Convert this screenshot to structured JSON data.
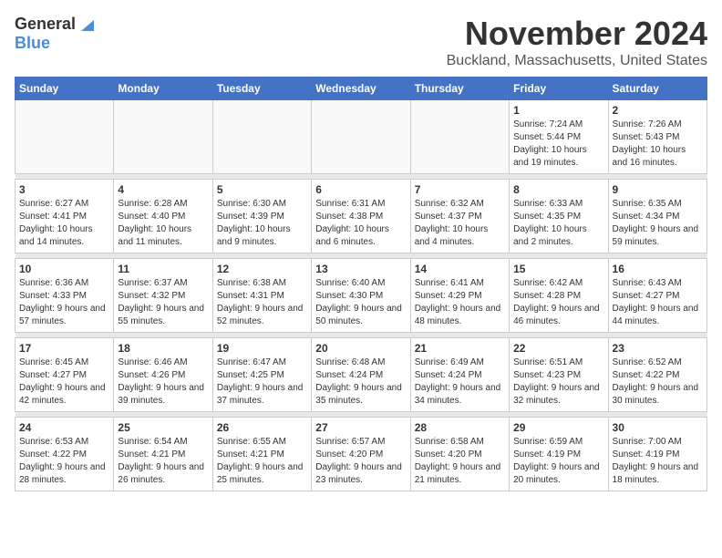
{
  "logo": {
    "general": "General",
    "blue": "Blue"
  },
  "header": {
    "month": "November 2024",
    "location": "Buckland, Massachusetts, United States"
  },
  "weekdays": [
    "Sunday",
    "Monday",
    "Tuesday",
    "Wednesday",
    "Thursday",
    "Friday",
    "Saturday"
  ],
  "weeks": [
    [
      {
        "day": "",
        "info": ""
      },
      {
        "day": "",
        "info": ""
      },
      {
        "day": "",
        "info": ""
      },
      {
        "day": "",
        "info": ""
      },
      {
        "day": "",
        "info": ""
      },
      {
        "day": "1",
        "info": "Sunrise: 7:24 AM\nSunset: 5:44 PM\nDaylight: 10 hours and 19 minutes."
      },
      {
        "day": "2",
        "info": "Sunrise: 7:26 AM\nSunset: 5:43 PM\nDaylight: 10 hours and 16 minutes."
      }
    ],
    [
      {
        "day": "3",
        "info": "Sunrise: 6:27 AM\nSunset: 4:41 PM\nDaylight: 10 hours and 14 minutes."
      },
      {
        "day": "4",
        "info": "Sunrise: 6:28 AM\nSunset: 4:40 PM\nDaylight: 10 hours and 11 minutes."
      },
      {
        "day": "5",
        "info": "Sunrise: 6:30 AM\nSunset: 4:39 PM\nDaylight: 10 hours and 9 minutes."
      },
      {
        "day": "6",
        "info": "Sunrise: 6:31 AM\nSunset: 4:38 PM\nDaylight: 10 hours and 6 minutes."
      },
      {
        "day": "7",
        "info": "Sunrise: 6:32 AM\nSunset: 4:37 PM\nDaylight: 10 hours and 4 minutes."
      },
      {
        "day": "8",
        "info": "Sunrise: 6:33 AM\nSunset: 4:35 PM\nDaylight: 10 hours and 2 minutes."
      },
      {
        "day": "9",
        "info": "Sunrise: 6:35 AM\nSunset: 4:34 PM\nDaylight: 9 hours and 59 minutes."
      }
    ],
    [
      {
        "day": "10",
        "info": "Sunrise: 6:36 AM\nSunset: 4:33 PM\nDaylight: 9 hours and 57 minutes."
      },
      {
        "day": "11",
        "info": "Sunrise: 6:37 AM\nSunset: 4:32 PM\nDaylight: 9 hours and 55 minutes."
      },
      {
        "day": "12",
        "info": "Sunrise: 6:38 AM\nSunset: 4:31 PM\nDaylight: 9 hours and 52 minutes."
      },
      {
        "day": "13",
        "info": "Sunrise: 6:40 AM\nSunset: 4:30 PM\nDaylight: 9 hours and 50 minutes."
      },
      {
        "day": "14",
        "info": "Sunrise: 6:41 AM\nSunset: 4:29 PM\nDaylight: 9 hours and 48 minutes."
      },
      {
        "day": "15",
        "info": "Sunrise: 6:42 AM\nSunset: 4:28 PM\nDaylight: 9 hours and 46 minutes."
      },
      {
        "day": "16",
        "info": "Sunrise: 6:43 AM\nSunset: 4:27 PM\nDaylight: 9 hours and 44 minutes."
      }
    ],
    [
      {
        "day": "17",
        "info": "Sunrise: 6:45 AM\nSunset: 4:27 PM\nDaylight: 9 hours and 42 minutes."
      },
      {
        "day": "18",
        "info": "Sunrise: 6:46 AM\nSunset: 4:26 PM\nDaylight: 9 hours and 39 minutes."
      },
      {
        "day": "19",
        "info": "Sunrise: 6:47 AM\nSunset: 4:25 PM\nDaylight: 9 hours and 37 minutes."
      },
      {
        "day": "20",
        "info": "Sunrise: 6:48 AM\nSunset: 4:24 PM\nDaylight: 9 hours and 35 minutes."
      },
      {
        "day": "21",
        "info": "Sunrise: 6:49 AM\nSunset: 4:24 PM\nDaylight: 9 hours and 34 minutes."
      },
      {
        "day": "22",
        "info": "Sunrise: 6:51 AM\nSunset: 4:23 PM\nDaylight: 9 hours and 32 minutes."
      },
      {
        "day": "23",
        "info": "Sunrise: 6:52 AM\nSunset: 4:22 PM\nDaylight: 9 hours and 30 minutes."
      }
    ],
    [
      {
        "day": "24",
        "info": "Sunrise: 6:53 AM\nSunset: 4:22 PM\nDaylight: 9 hours and 28 minutes."
      },
      {
        "day": "25",
        "info": "Sunrise: 6:54 AM\nSunset: 4:21 PM\nDaylight: 9 hours and 26 minutes."
      },
      {
        "day": "26",
        "info": "Sunrise: 6:55 AM\nSunset: 4:21 PM\nDaylight: 9 hours and 25 minutes."
      },
      {
        "day": "27",
        "info": "Sunrise: 6:57 AM\nSunset: 4:20 PM\nDaylight: 9 hours and 23 minutes."
      },
      {
        "day": "28",
        "info": "Sunrise: 6:58 AM\nSunset: 4:20 PM\nDaylight: 9 hours and 21 minutes."
      },
      {
        "day": "29",
        "info": "Sunrise: 6:59 AM\nSunset: 4:19 PM\nDaylight: 9 hours and 20 minutes."
      },
      {
        "day": "30",
        "info": "Sunrise: 7:00 AM\nSunset: 4:19 PM\nDaylight: 9 hours and 18 minutes."
      }
    ]
  ]
}
